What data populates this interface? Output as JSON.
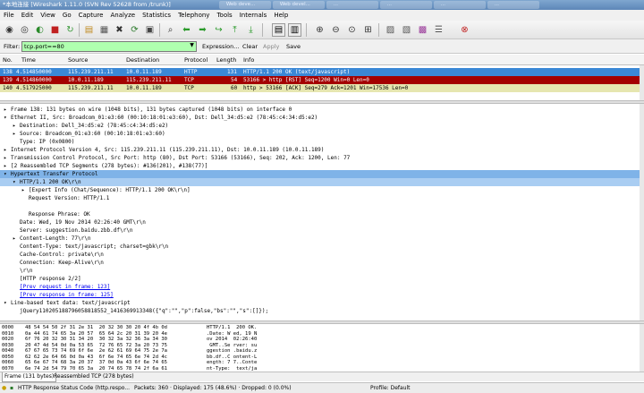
{
  "window": {
    "title": "*本地连接   [Wireshark 1.11.0  (SVN Rev 52628 from /trunk)]",
    "tabs": [
      "Web deve...",
      "Web devel...",
      "...",
      "...",
      "...",
      "..."
    ]
  },
  "menu": [
    "File",
    "Edit",
    "View",
    "Go",
    "Capture",
    "Analyze",
    "Statistics",
    "Telephony",
    "Tools",
    "Internals",
    "Help"
  ],
  "toolbar_icons": [
    "interface-list-icon",
    "capture-options-icon",
    "start-capture-icon",
    "stop-capture-icon",
    "restart-capture-icon",
    "open-file-icon",
    "save-file-icon",
    "close-file-icon",
    "reload-icon",
    "find-packet-icon",
    "go-back-icon",
    "go-forward-icon",
    "go-to-packet-icon",
    "go-first-icon",
    "go-last-icon",
    "colorize-icon",
    "auto-scroll-icon",
    "zoom-in-icon",
    "zoom-out-icon",
    "zoom-normal-icon",
    "resize-columns-icon",
    "capture-filters-icon",
    "display-filters-icon",
    "coloring-rules-icon",
    "preferences-icon",
    "help-icon"
  ],
  "filter": {
    "label": "Filter:",
    "value": "tcp.port==80",
    "expression": "Expression...",
    "clear": "Clear",
    "apply": "Apply",
    "save": "Save"
  },
  "columns": [
    "No.",
    "Time",
    "Source",
    "Destination",
    "Protocol",
    "Length",
    "Info"
  ],
  "packets": [
    {
      "no": "138",
      "time": "4.514850000",
      "src": "115.239.211.11",
      "dst": "10.0.11.189",
      "proto": "HTTP",
      "len": "131",
      "info": "HTTP/1.1 200 OK  (text/javascript)",
      "style": "sel"
    },
    {
      "no": "139",
      "time": "4.514860000",
      "src": "10.0.11.189",
      "dst": "115.239.211.11",
      "proto": "TCP",
      "len": "54",
      "info": "53166 > http [RST] Seq=1200 Win=0 Len=0",
      "style": "red"
    },
    {
      "no": "140",
      "time": "4.517925000",
      "src": "115.239.211.11",
      "dst": "10.0.11.189",
      "proto": "TCP",
      "len": "60",
      "info": "http > 53166 [ACK] Seq=279 Ack=1201 Win=17536 Len=0",
      "style": "yel"
    }
  ],
  "details": [
    {
      "indent": 0,
      "tw": "▸",
      "text": "Frame 138: 131 bytes on wire (1048 bits), 131 bytes captured (1048 bits) on interface 0"
    },
    {
      "indent": 0,
      "tw": "▾",
      "text": "Ethernet II, Src: Broadcom_01:e3:60 (00:10:18:01:e3:60), Dst: Dell_34:d5:e2 (78:45:c4:34:d5:e2)"
    },
    {
      "indent": 1,
      "tw": "▸",
      "text": "Destination: Dell_34:d5:e2 (78:45:c4:34:d5:e2)"
    },
    {
      "indent": 1,
      "tw": "▸",
      "text": "Source: Broadcom_01:e3:60 (00:10:18:01:e3:60)"
    },
    {
      "indent": 1,
      "tw": "",
      "text": "Type: IP (0x0800)"
    },
    {
      "indent": 0,
      "tw": "▸",
      "text": "Internet Protocol Version 4, Src: 115.239.211.11 (115.239.211.11), Dst: 10.0.11.189 (10.0.11.189)"
    },
    {
      "indent": 0,
      "tw": "▸",
      "text": "Transmission Control Protocol, Src Port: http (80), Dst Port: 53166 (53166), Seq: 202, Ack: 1200, Len: 77"
    },
    {
      "indent": 0,
      "tw": "▸",
      "text": "[2 Reassembled TCP Segments (278 bytes): #136(201), #138(77)]"
    },
    {
      "indent": 0,
      "tw": "▾",
      "text": "Hypertext Transfer Protocol",
      "hl": "hl"
    },
    {
      "indent": 1,
      "tw": "▾",
      "text": "HTTP/1.1 200 OK\\r\\n",
      "hl": "hl2"
    },
    {
      "indent": 2,
      "tw": "▸",
      "text": "[Expert Info (Chat/Sequence): HTTP/1.1 200 OK\\r\\n]"
    },
    {
      "indent": 2,
      "tw": "",
      "text": "Request Version: HTTP/1.1"
    },
    {
      "indent": 2,
      "tw": "",
      "text": ""
    },
    {
      "indent": 2,
      "tw": "",
      "text": "Response Phrase: OK"
    },
    {
      "indent": 1,
      "tw": "",
      "text": "Date: Wed, 19 Nov 2014 02:26:40 GMT\\r\\n"
    },
    {
      "indent": 1,
      "tw": "",
      "text": "Server: suggestion.baidu.zbb.df\\r\\n"
    },
    {
      "indent": 1,
      "tw": "▸",
      "text": "Content-Length: 77\\r\\n"
    },
    {
      "indent": 1,
      "tw": "",
      "text": "Content-Type: text/javascript; charset=gbk\\r\\n"
    },
    {
      "indent": 1,
      "tw": "",
      "text": "Cache-Control: private\\r\\n"
    },
    {
      "indent": 1,
      "tw": "",
      "text": "Connection: Keep-Alive\\r\\n"
    },
    {
      "indent": 1,
      "tw": "",
      "text": "\\r\\n"
    },
    {
      "indent": 1,
      "tw": "",
      "text": "[HTTP response 2/2]"
    },
    {
      "indent": 1,
      "tw": "",
      "text": "[Prev request in frame: 123]",
      "link": true
    },
    {
      "indent": 1,
      "tw": "",
      "text": "[Prev response in frame: 125]",
      "link": true
    },
    {
      "indent": 0,
      "tw": "▾",
      "text": "Line-based text data: text/javascript"
    },
    {
      "indent": 1,
      "tw": "",
      "text": "jQuery110205188796058818552_1416369913348({\"q\":\"\",\"p\":false,\"bs\":\"\",\"s\":[]});"
    }
  ],
  "bytes": [
    {
      "off": "0000",
      "hex": "48 54 54 50 2f 31 2e 31  20 32 30 30 20 4f 4b 0d",
      "asc": "HTTP/1.1  200 OK."
    },
    {
      "off": "0010",
      "hex": "0a 44 61 74 65 3a 20 57  65 64 2c 20 31 39 20 4e",
      "asc": ".Date: W ed, 19 N"
    },
    {
      "off": "0020",
      "hex": "6f 76 20 32 30 31 34 20  30 32 3a 32 36 3a 34 30",
      "asc": "ov 2014  02:26:40"
    },
    {
      "off": "0030",
      "hex": "20 47 4d 54 0d 0a 53 65  72 76 65 72 3a 20 73 75",
      "asc": " GMT..Se rver: su"
    },
    {
      "off": "0040",
      "hex": "67 67 65 73 74 69 6f 6e  2e 62 61 69 64 75 2e 7a",
      "asc": "ggestion .baidu.z"
    },
    {
      "off": "0050",
      "hex": "62 62 2e 64 66 0d 0a 43  6f 6e 74 65 6e 74 2d 4c",
      "asc": "bb.df..C ontent-L"
    },
    {
      "off": "0060",
      "hex": "65 6e 67 74 68 3a 20 37  37 0d 0a 43 6f 6e 74 65",
      "asc": "ength: 7 7..Conte"
    },
    {
      "off": "0070",
      "hex": "6e 74 2d 54 79 70 65 3a  20 74 65 78 74 2f 6a 61",
      "asc": "nt-Type:  text/ja"
    }
  ],
  "byte_tabs": [
    "Frame (131 bytes)",
    "Reassembled TCP (278 bytes)"
  ],
  "status": {
    "field": "HTTP Response Status Code (http.respo...",
    "packets": "Packets: 360 · Displayed: 175 (48.6%) · Dropped: 0 (0.0%)",
    "profile": "Profile: Default"
  }
}
